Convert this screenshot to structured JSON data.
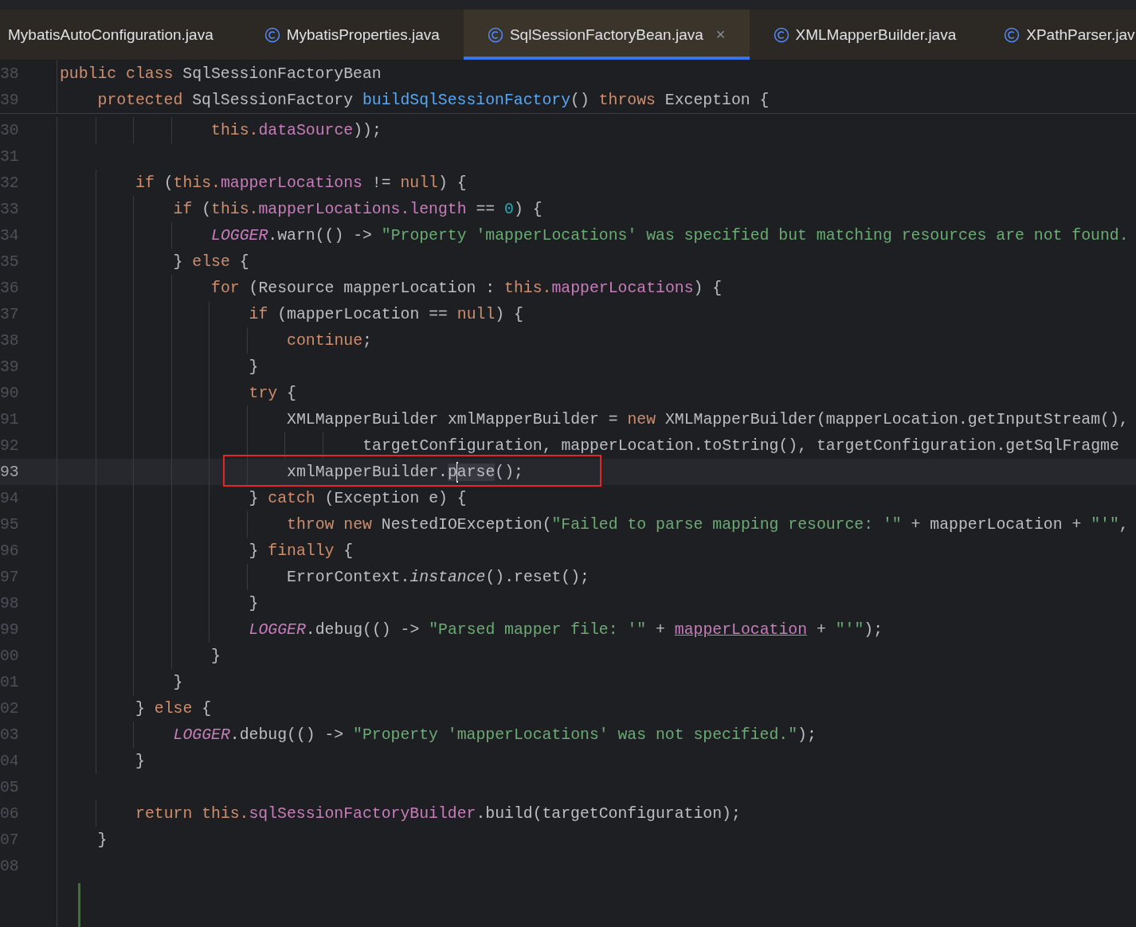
{
  "tabs": [
    {
      "label": "MybatisAutoConfiguration.java",
      "selected": false,
      "icon": false,
      "closable": false
    },
    {
      "label": "MybatisProperties.java",
      "selected": false,
      "icon": true,
      "closable": false
    },
    {
      "label": "SqlSessionFactoryBean.java",
      "selected": true,
      "icon": true,
      "closable": true,
      "close": "×"
    },
    {
      "label": "XMLMapperBuilder.java",
      "selected": false,
      "icon": true,
      "closable": false
    },
    {
      "label": "XPathParser.jav",
      "selected": false,
      "icon": true,
      "closable": false
    }
  ],
  "sticky_lines": [
    {
      "number": "38",
      "tokens": [
        {
          "t": "public",
          "kind": "kw"
        },
        {
          "t": " class",
          "kind": "kw"
        },
        {
          "t": " SqlSessionFactoryBean",
          "kind": "plain"
        }
      ]
    },
    {
      "number": "39",
      "tokens": [
        {
          "t": "    protected",
          "kind": "kw"
        },
        {
          "t": " SqlSessionFactory ",
          "kind": "plain"
        },
        {
          "t": "buildSqlSessionFactory",
          "kind": "decl"
        },
        {
          "t": "() ",
          "kind": "plain"
        },
        {
          "t": "throws",
          "kind": "kw"
        },
        {
          "t": " Exception {",
          "kind": "plain"
        }
      ]
    }
  ],
  "lines": [
    {
      "number": "30",
      "tokens": [
        {
          "t": "                this.",
          "kind": "kw"
        },
        {
          "t": "dataSource",
          "kind": "field"
        },
        {
          "t": "));",
          "kind": "plain"
        }
      ]
    },
    {
      "number": "31"
    },
    {
      "number": "32",
      "tokens": [
        {
          "t": "        if",
          "kind": "kw"
        },
        {
          "t": " (",
          "kind": "plain"
        },
        {
          "t": "this.",
          "kind": "kw"
        },
        {
          "t": "mapperLocations",
          "kind": "field"
        },
        {
          "t": " != ",
          "kind": "plain"
        },
        {
          "t": "null",
          "kind": "kw"
        },
        {
          "t": ") {",
          "kind": "plain"
        }
      ]
    },
    {
      "number": "33",
      "tokens": [
        {
          "t": "            if",
          "kind": "kw"
        },
        {
          "t": " (",
          "kind": "plain"
        },
        {
          "t": "this.",
          "kind": "kw"
        },
        {
          "t": "mapperLocations.length",
          "kind": "field"
        },
        {
          "t": " == ",
          "kind": "plain"
        },
        {
          "t": "0",
          "kind": "num"
        },
        {
          "t": ") {",
          "kind": "plain"
        }
      ]
    },
    {
      "number": "34",
      "tokens": [
        {
          "t": "                LOGGER",
          "kind": "static"
        },
        {
          "t": ".warn(() -> ",
          "kind": "plain"
        },
        {
          "t": "\"Property 'mapperLocations' was specified but matching resources are not found.",
          "kind": "str"
        }
      ]
    },
    {
      "number": "35",
      "tokens": [
        {
          "t": "            } ",
          "kind": "plain"
        },
        {
          "t": "else",
          "kind": "kw"
        },
        {
          "t": " {",
          "kind": "plain"
        }
      ]
    },
    {
      "number": "36",
      "tokens": [
        {
          "t": "                for",
          "kind": "kw"
        },
        {
          "t": " (Resource mapperLocation : ",
          "kind": "plain"
        },
        {
          "t": "this.",
          "kind": "kw"
        },
        {
          "t": "mapperLocations",
          "kind": "field"
        },
        {
          "t": ") {",
          "kind": "plain"
        }
      ]
    },
    {
      "number": "37",
      "tokens": [
        {
          "t": "                    if",
          "kind": "kw"
        },
        {
          "t": " (mapperLocation == ",
          "kind": "plain"
        },
        {
          "t": "null",
          "kind": "kw"
        },
        {
          "t": ") {",
          "kind": "plain"
        }
      ]
    },
    {
      "number": "38",
      "tokens": [
        {
          "t": "                        continue",
          "kind": "kw"
        },
        {
          "t": ";",
          "kind": "plain"
        }
      ]
    },
    {
      "number": "39",
      "tokens": [
        {
          "t": "                    }",
          "kind": "plain"
        }
      ]
    },
    {
      "number": "90",
      "tokens": [
        {
          "t": "                    try",
          "kind": "kw"
        },
        {
          "t": " {",
          "kind": "plain"
        }
      ]
    },
    {
      "number": "91",
      "tokens": [
        {
          "t": "                        XMLMapperBuilder xmlMapperBuilder = ",
          "kind": "plain"
        },
        {
          "t": "new",
          "kind": "kw"
        },
        {
          "t": " XMLMapperBuilder(mapperLocation.getInputStream(),",
          "kind": "plain"
        }
      ]
    },
    {
      "number": "92",
      "tokens": [
        {
          "t": "                                targetConfiguration, mapperLocation.toString(), targetConfiguration.getSqlFragme",
          "kind": "plain"
        }
      ]
    },
    {
      "number": "93",
      "current": true,
      "tokens": [
        {
          "t": "                        xmlMapperBuilder.",
          "kind": "plain"
        },
        {
          "t": "p",
          "kind": "match"
        },
        {
          "t": "arse",
          "kind": "match",
          "caret_before": true
        },
        {
          "t": "();",
          "kind": "plain"
        }
      ]
    },
    {
      "number": "94",
      "tokens": [
        {
          "t": "                    } ",
          "kind": "plain"
        },
        {
          "t": "catch",
          "kind": "kw"
        },
        {
          "t": " (Exception e) {",
          "kind": "plain"
        }
      ]
    },
    {
      "number": "95",
      "tokens": [
        {
          "t": "                        throw",
          "kind": "kw"
        },
        {
          "t": " new",
          "kind": "kw"
        },
        {
          "t": " NestedIOException(",
          "kind": "plain"
        },
        {
          "t": "\"Failed to parse mapping resource: '\"",
          "kind": "str"
        },
        {
          "t": " + mapperLocation + ",
          "kind": "plain"
        },
        {
          "t": "\"'\"",
          "kind": "str"
        },
        {
          "t": ",",
          "kind": "plain"
        }
      ]
    },
    {
      "number": "96",
      "tokens": [
        {
          "t": "                    } ",
          "kind": "plain"
        },
        {
          "t": "finally",
          "kind": "kw"
        },
        {
          "t": " {",
          "kind": "plain"
        }
      ]
    },
    {
      "number": "97",
      "tokens": [
        {
          "t": "                        ErrorContext.",
          "kind": "plain"
        },
        {
          "t": "instance",
          "kind": "italic"
        },
        {
          "t": "().reset();",
          "kind": "plain"
        }
      ]
    },
    {
      "number": "98",
      "tokens": [
        {
          "t": "                    }",
          "kind": "plain"
        }
      ]
    },
    {
      "number": "99",
      "tokens": [
        {
          "t": "                    LOGGER",
          "kind": "static"
        },
        {
          "t": ".debug(() -> ",
          "kind": "plain"
        },
        {
          "t": "\"Parsed mapper file: '\"",
          "kind": "str"
        },
        {
          "t": " + ",
          "kind": "plain"
        },
        {
          "t": "mapperLocation",
          "kind": "link"
        },
        {
          "t": " + ",
          "kind": "plain"
        },
        {
          "t": "\"'\"",
          "kind": "str"
        },
        {
          "t": ");",
          "kind": "plain"
        }
      ]
    },
    {
      "number": "00",
      "tokens": [
        {
          "t": "                }",
          "kind": "plain"
        }
      ]
    },
    {
      "number": "01",
      "tokens": [
        {
          "t": "            }",
          "kind": "plain"
        }
      ]
    },
    {
      "number": "02",
      "tokens": [
        {
          "t": "        } ",
          "kind": "plain"
        },
        {
          "t": "else",
          "kind": "kw"
        },
        {
          "t": " {",
          "kind": "plain"
        }
      ]
    },
    {
      "number": "03",
      "tokens": [
        {
          "t": "            LOGGER",
          "kind": "static"
        },
        {
          "t": ".debug(() -> ",
          "kind": "plain"
        },
        {
          "t": "\"Property 'mapperLocations' was not specified.\"",
          "kind": "str"
        },
        {
          "t": ");",
          "kind": "plain"
        }
      ]
    },
    {
      "number": "04",
      "tokens": [
        {
          "t": "        }",
          "kind": "plain"
        }
      ]
    },
    {
      "number": "05"
    },
    {
      "number": "06",
      "tokens": [
        {
          "t": "        return",
          "kind": "kw"
        },
        {
          "t": " this.",
          "kind": "kw"
        },
        {
          "t": "sqlSessionFactoryBuilder",
          "kind": "field"
        },
        {
          "t": ".build(targetConfiguration);",
          "kind": "plain"
        }
      ]
    },
    {
      "number": "07",
      "tokens": [
        {
          "t": "    }",
          "kind": "plain"
        }
      ]
    },
    {
      "number": "08"
    }
  ]
}
